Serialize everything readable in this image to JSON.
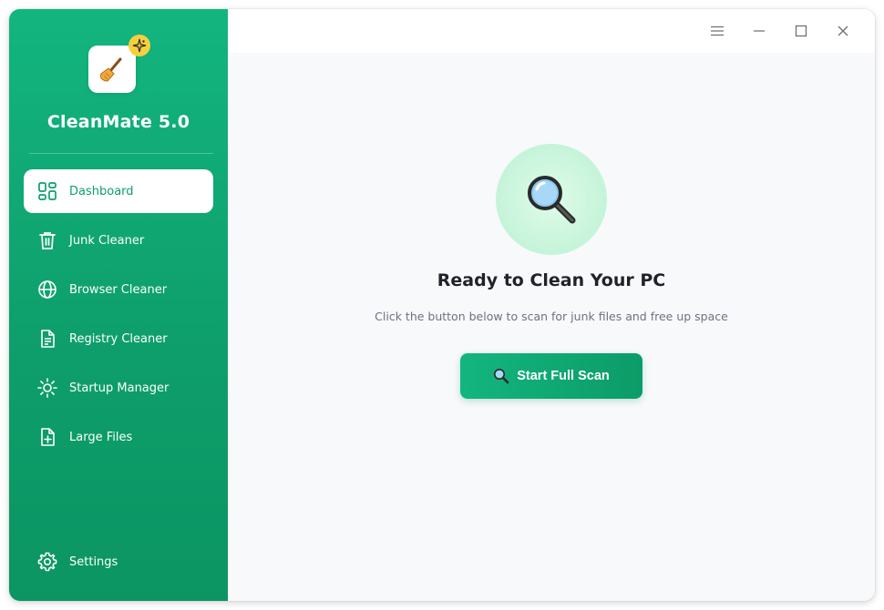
{
  "app": {
    "name": "CleanMate 5.0",
    "logo_icon": "broom-icon",
    "badge_icon": "sparkle-icon",
    "accent_color": "#10a873",
    "badge_color": "#f7cf3e"
  },
  "sidebar": {
    "items": [
      {
        "label": "Dashboard",
        "icon": "dashboard-grid-icon",
        "active": true
      },
      {
        "label": "Junk Cleaner",
        "icon": "trash-icon",
        "active": false
      },
      {
        "label": "Browser Cleaner",
        "icon": "globe-icon",
        "active": false
      },
      {
        "label": "Registry Cleaner",
        "icon": "document-icon",
        "active": false
      },
      {
        "label": "Startup Manager",
        "icon": "sun-icon",
        "active": false
      },
      {
        "label": "Large Files",
        "icon": "file-plus-icon",
        "active": false
      }
    ],
    "settings_label": "Settings"
  },
  "window_controls": {
    "menu": "hamburger-menu-icon",
    "minimize": "minimize-icon",
    "maximize": "maximize-icon",
    "close": "close-icon"
  },
  "main": {
    "hero_icon": "magnifier-icon",
    "headline": "Ready to Clean Your PC",
    "subline": "Click the button below to scan for junk files and free up space",
    "scan_button_label": "Start Full Scan",
    "scan_button_icon": "magnifier-icon"
  }
}
